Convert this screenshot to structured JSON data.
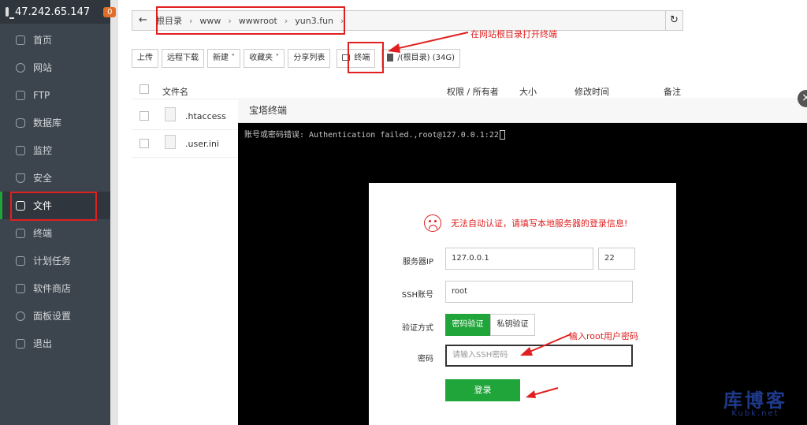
{
  "sidebar": {
    "server_ip": "47.242.65.147",
    "badge": "0",
    "items": [
      {
        "label": "首页",
        "icon": "home-icon"
      },
      {
        "label": "网站",
        "icon": "globe-icon"
      },
      {
        "label": "FTP",
        "icon": "ftp-icon"
      },
      {
        "label": "数据库",
        "icon": "database-icon"
      },
      {
        "label": "监控",
        "icon": "monitor-icon"
      },
      {
        "label": "安全",
        "icon": "shield-icon"
      },
      {
        "label": "文件",
        "icon": "folder-icon",
        "active": true
      },
      {
        "label": "终端",
        "icon": "terminal-icon"
      },
      {
        "label": "计划任务",
        "icon": "calendar-icon"
      },
      {
        "label": "软件商店",
        "icon": "grid-icon"
      },
      {
        "label": "面板设置",
        "icon": "gear-icon"
      },
      {
        "label": "退出",
        "icon": "logout-icon"
      }
    ]
  },
  "breadcrumb": [
    "根目录",
    "www",
    "wwwroot",
    "yun3.fun"
  ],
  "toolbar": {
    "upload": "上传",
    "remote_download": "远程下载",
    "new": "新建",
    "favorites": "收藏夹",
    "share_list": "分享列表",
    "terminal": "终端",
    "disk": "/(根目录) (34G)"
  },
  "table": {
    "headers": {
      "name": "文件名",
      "perm": "权限 / 所有者",
      "size": "大小",
      "mtime": "修改时间",
      "note": "备注"
    },
    "rows": [
      {
        "name": ".htaccess"
      },
      {
        "name": ".user.ini"
      }
    ]
  },
  "annotations": {
    "open_terminal": "在网站根目录打开终端",
    "enter_password": "输入root用户密码"
  },
  "terminal": {
    "title": "宝塔终端",
    "error_line": "账号或密码错误: Authentication failed.,root@127.0.0.1:22"
  },
  "login_dialog": {
    "message": "无法自动认证，请填写本地服务器的登录信息!",
    "server_ip_label": "服务器IP",
    "server_ip": "127.0.0.1",
    "port": "22",
    "ssh_user_label": "SSH账号",
    "ssh_user": "root",
    "auth_label": "验证方式",
    "auth_password": "密码验证",
    "auth_key": "私钥验证",
    "password_label": "密码",
    "password_placeholder": "请输入SSH密码",
    "login_button": "登录"
  },
  "watermark": {
    "line1": "库博客",
    "line2": "Kubk.net"
  },
  "colors": {
    "accent": "#20a53a",
    "annotation": "#e02020",
    "sidebar": "#3c444d"
  }
}
